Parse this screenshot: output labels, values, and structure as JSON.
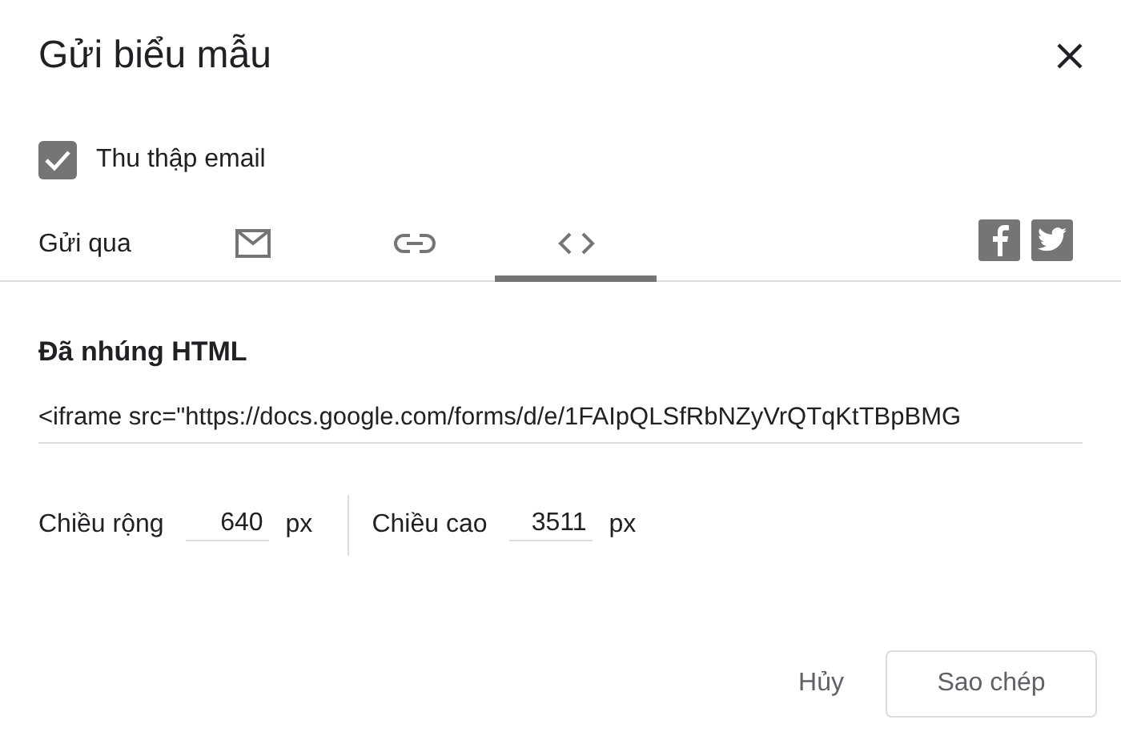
{
  "dialog": {
    "title": "Gửi biểu mẫu"
  },
  "collect_email": {
    "label": "Thu thập email",
    "checked": true
  },
  "send_via": {
    "label": "Gửi qua",
    "tabs": [
      {
        "kind": "email",
        "selected": false
      },
      {
        "kind": "link",
        "selected": false
      },
      {
        "kind": "embed",
        "selected": true
      }
    ],
    "share": [
      {
        "kind": "facebook"
      },
      {
        "kind": "twitter"
      }
    ]
  },
  "embed": {
    "heading": "Đã nhúng HTML",
    "code": "<iframe src=\"https://docs.google.com/forms/d/e/1FAIpQLSfRbNZyVrQTqKtTBpBMG",
    "width": {
      "label": "Chiều rộng",
      "value": "640",
      "unit": "px"
    },
    "height": {
      "label": "Chiều cao",
      "value": "3511",
      "unit": "px"
    }
  },
  "buttons": [
    {
      "label": "Hủy",
      "kind": "text"
    },
    {
      "label": "Sao chép",
      "kind": "outlined"
    }
  ]
}
